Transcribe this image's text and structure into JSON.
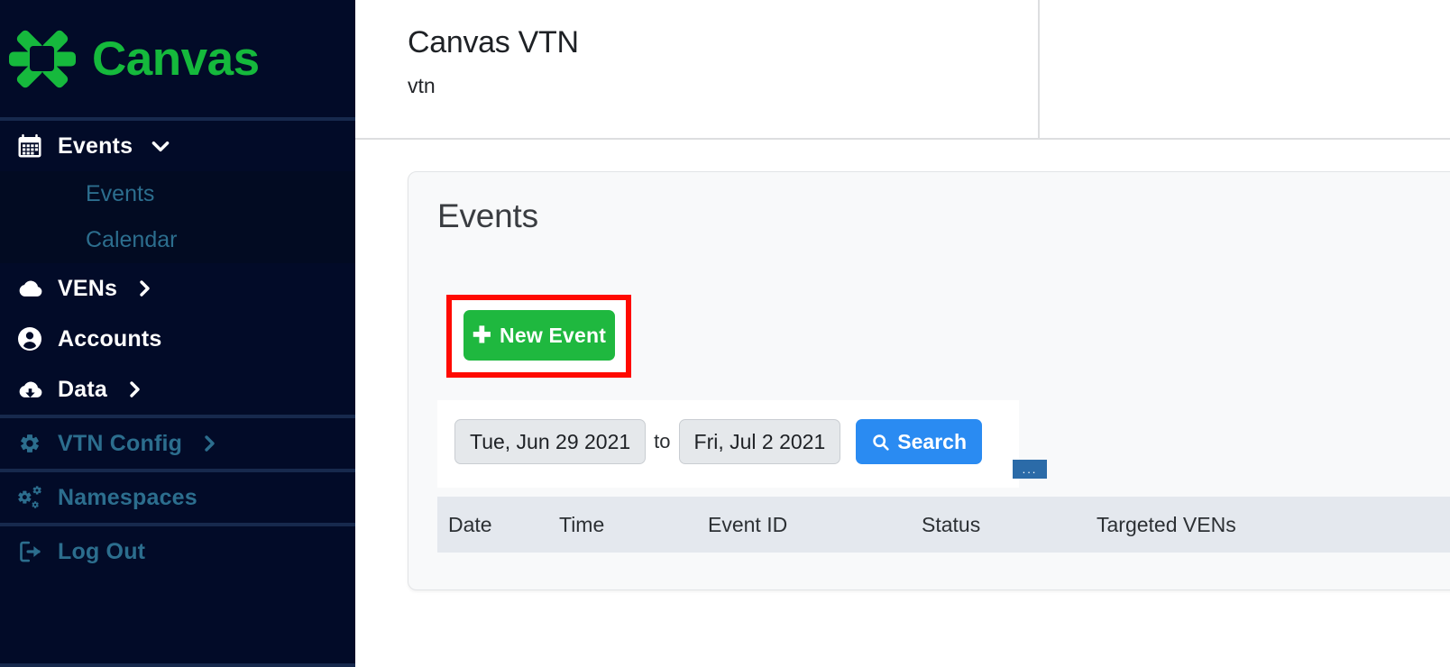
{
  "brand": {
    "name": "Canvas",
    "logo_icon": "canvas-starburst-logo"
  },
  "sidebar": {
    "primary": [
      {
        "label": "Events",
        "icon": "calendar-icon",
        "caret": "chevron-down-icon",
        "expanded": true
      },
      {
        "label": "VENs",
        "icon": "cloud-icon",
        "caret": "chevron-right-icon",
        "expanded": false
      },
      {
        "label": "Accounts",
        "icon": "user-circle-icon",
        "caret": "",
        "expanded": false
      },
      {
        "label": "Data",
        "icon": "cloud-download-icon",
        "caret": "chevron-right-icon",
        "expanded": false
      }
    ],
    "sub_items": [
      {
        "label": "Events"
      },
      {
        "label": "Calendar"
      }
    ],
    "secondary": [
      {
        "label": "VTN Config",
        "icon": "gear-icon",
        "caret": "chevron-right-icon"
      },
      {
        "label": "Namespaces",
        "icon": "gears-icon",
        "caret": ""
      },
      {
        "label": "Log Out",
        "icon": "logout-icon",
        "caret": ""
      }
    ]
  },
  "header": {
    "title": "Canvas VTN",
    "subtitle": "vtn"
  },
  "events_card": {
    "title": "Events",
    "new_event_button": {
      "label": "New Event",
      "plus_icon": "plus-icon",
      "highlighted": true,
      "highlight_color": "#FF0A00",
      "button_color": "#1FB83F"
    },
    "filter": {
      "start_date": "Tue, Jun 29 2021",
      "separator_label": "to",
      "end_date": "Fri, Jul 2 2021",
      "search_button": {
        "label": "Search",
        "icon": "search-icon",
        "color": "#2A8BF2"
      },
      "overflow_badge": "..."
    },
    "table": {
      "columns": [
        "Date",
        "Time",
        "Event ID",
        "Status",
        "Targeted VENs"
      ],
      "rows": []
    }
  },
  "colors": {
    "sidebar_bg": "#020B28",
    "brand_green": "#15B93C",
    "muted_link": "#2C6E8E",
    "accent_blue": "#2A8BF2",
    "highlight_red": "#FF0A00"
  }
}
